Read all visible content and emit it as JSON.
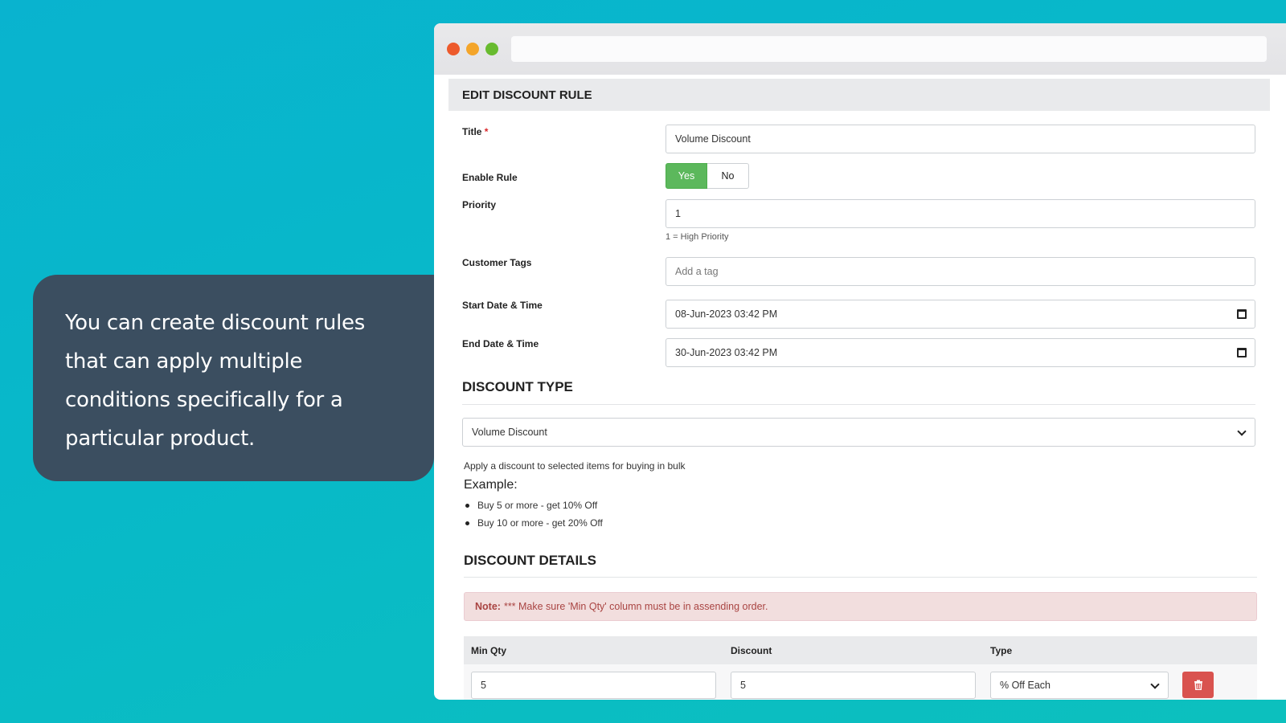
{
  "callout": {
    "text": "You can create discount rules that can apply multiple conditions specifically for a particular product."
  },
  "form": {
    "header": "EDIT DISCOUNT RULE",
    "title_label": "Title",
    "title_required_mark": "*",
    "title_value": "Volume Discount",
    "enable_label": "Enable Rule",
    "enable_yes": "Yes",
    "enable_no": "No",
    "enable_selected": "Yes",
    "priority_label": "Priority",
    "priority_value": "1",
    "priority_hint": "1 = High Priority",
    "tags_label": "Customer Tags",
    "tags_placeholder": "Add a tag",
    "start_label": "Start Date & Time",
    "start_value": "08-Jun-2023 03:42 PM",
    "end_label": "End Date & Time",
    "end_value": "30-Jun-2023 03:42 PM"
  },
  "discount_type": {
    "heading": "DISCOUNT TYPE",
    "selected": "Volume Discount",
    "description": "Apply a discount to selected items for buying in bulk",
    "example_heading": "Example:",
    "examples": [
      "Buy 5 or more - get 10% Off",
      "Buy 10 or more - get 20% Off"
    ]
  },
  "discount_details": {
    "heading": "DISCOUNT DETAILS",
    "note_label": "Note:",
    "note_text": "*** Make sure 'Min Qty' column must be in assending order.",
    "columns": [
      "Min Qty",
      "Discount",
      "Type"
    ],
    "rows": [
      {
        "min_qty": "5",
        "discount": "5",
        "type": "% Off Each"
      }
    ]
  },
  "colors": {
    "background_start": "#09b3cf",
    "background_end": "#0cc0be",
    "callout": "#3b4e60",
    "toggle_active": "#5cb85c",
    "note_bg": "#f2dede",
    "delete_button": "#d9534f"
  }
}
